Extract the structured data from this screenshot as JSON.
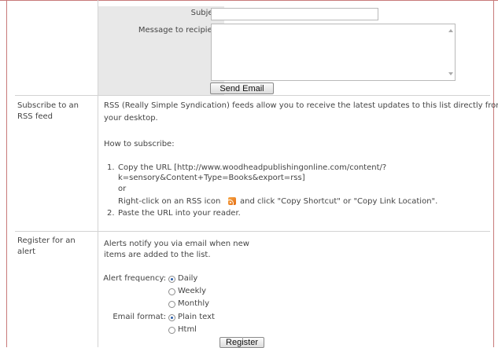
{
  "email_form": {
    "subject_label": "Subject",
    "subject_value": "",
    "message_label": "Message to recipient",
    "message_value": "",
    "send_button": "Send Email"
  },
  "rss": {
    "heading_line1": "Subscribe to an",
    "heading_line2": "RSS feed",
    "intro_line1": "RSS (Really Simple Syndication) feeds allow you to receive the latest updates to this list directly from",
    "intro_line2": "your desktop.",
    "how_to": "How to subscribe:",
    "step1_num": "1.",
    "step1_line1": "Copy the URL [http://www.woodheadpublishingonline.com/content/?",
    "step1_line2": "k=sensory&Content+Type=Books&export=rss]",
    "step1_or": "or",
    "step1_alt_before": "Right-click on an RSS icon",
    "step1_alt_after": "and click \"Copy Shortcut\" or \"Copy Link Location\".",
    "step2_num": "2.",
    "step2_text": "Paste the URL into your reader.",
    "icon": "rss-icon"
  },
  "alert": {
    "heading_line1": "Register for an",
    "heading_line2": "alert",
    "intro_line1": "Alerts notify you via email when new",
    "intro_line2": "items are added to the list.",
    "frequency_label": "Alert frequency:",
    "frequency_options": [
      "Daily",
      "Weekly",
      "Monthly"
    ],
    "frequency_selected": "Daily",
    "format_label": "Email format:",
    "format_options": [
      "Plain text",
      "Html"
    ],
    "format_selected": "Plain text",
    "register_button": "Register"
  }
}
